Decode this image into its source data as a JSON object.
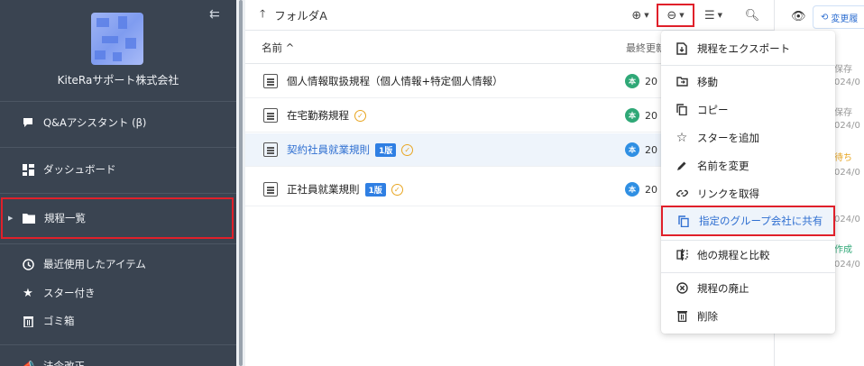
{
  "sidebar": {
    "company": "KiteRaサポート株式会社",
    "items": [
      {
        "label": "Q&Aアシスタント (β)",
        "icon": "chat-icon"
      },
      {
        "label": "ダッシュボード",
        "icon": "dashboard-icon"
      },
      {
        "label": "規程一覧",
        "icon": "folder-icon"
      },
      {
        "label": "最近使用したアイテム",
        "icon": "clock-icon"
      },
      {
        "label": "スター付き",
        "icon": "star-icon"
      },
      {
        "label": "ゴミ箱",
        "icon": "trash-icon"
      },
      {
        "label": "法令改正",
        "icon": "megaphone-icon"
      }
    ]
  },
  "toolbar": {
    "folder": "フォルダA"
  },
  "table": {
    "col_name": "名前 ^",
    "col_updated": "最終更新"
  },
  "rows": [
    {
      "title": "個人情報取扱規程（個人情報+特定個人情報）",
      "avatar": "本",
      "date": "20",
      "avatar_color": "#2fa877"
    },
    {
      "title": "在宅勤務規程",
      "avatar": "本",
      "date": "20",
      "avatar_color": "#2fa877"
    },
    {
      "title": "契約社員就業規則",
      "badge": "1版",
      "avatar": "本",
      "date": "20",
      "avatar_color": "#2f8fe3"
    },
    {
      "title": "正社員就業規則",
      "badge": "1版",
      "avatar": "本",
      "date": "20",
      "avatar_color": "#2f8fe3"
    }
  ],
  "right_panel": {
    "history_label": "変更履",
    "entries": [
      "保存",
      "024/0",
      "保存",
      "024/0",
      "待ち",
      "024/0",
      "024/0",
      "作成",
      "024/0"
    ]
  },
  "menu": {
    "items": [
      {
        "label": "規程をエクスポート",
        "icon": "export-icon"
      },
      {
        "label": "移動",
        "icon": "move-icon"
      },
      {
        "label": "コピー",
        "icon": "copy-icon"
      },
      {
        "label": "スターを追加",
        "icon": "star-outline-icon"
      },
      {
        "label": "名前を変更",
        "icon": "pencil-icon"
      },
      {
        "label": "リンクを取得",
        "icon": "link-icon"
      },
      {
        "label": "指定のグループ会社に共有",
        "icon": "share-copy-icon"
      },
      {
        "label": "他の規程と比較",
        "icon": "compare-icon"
      },
      {
        "label": "規程の廃止",
        "icon": "cancel-circle-icon"
      },
      {
        "label": "削除",
        "icon": "trash-icon"
      }
    ]
  },
  "colors": {
    "sidebar": "#3a4451",
    "accent": "#2f6fd1",
    "highlight": "#e0202a"
  }
}
